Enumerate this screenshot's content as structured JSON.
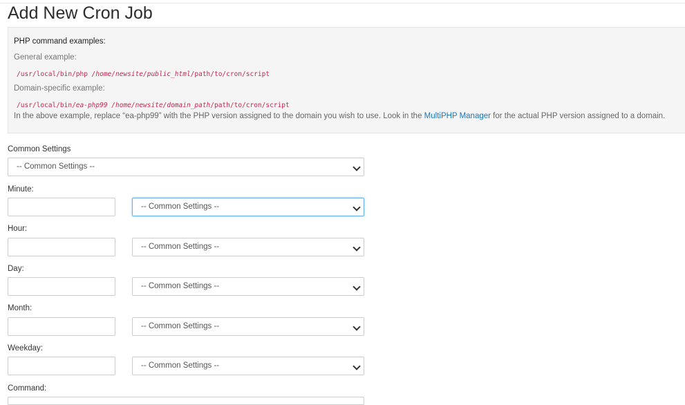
{
  "page": {
    "title": "Add New Cron Job"
  },
  "examples": {
    "heading": "PHP command examples:",
    "general_label": "General example:",
    "general_code_part1": "/usr/local/bin/php ",
    "general_code_part2": "/home/newsite/public_html",
    "general_code_part3": "/path/to/cron/script",
    "domain_label": "Domain-specific example:",
    "domain_code_part1": "/usr/local/bin/",
    "domain_code_part2": "ea-php99",
    "domain_code_part3": " /home/newsite/domain_path",
    "domain_code_part4": "/path/to/cron/script",
    "note_before": "In the above example, replace “ea-php99” with the PHP version assigned to the domain you wish to use. Look in the ",
    "note_link": "MultiPHP Manager",
    "note_after": " for the actual PHP version assigned to a domain."
  },
  "form": {
    "common_settings_label": "Common Settings",
    "common_settings_value": "-- Common Settings --",
    "minute_label": "Minute:",
    "minute_value": "",
    "minute_select": "-- Common Settings --",
    "hour_label": "Hour:",
    "hour_value": "",
    "hour_select": "-- Common Settings --",
    "day_label": "Day:",
    "day_value": "",
    "day_select": "-- Common Settings --",
    "month_label": "Month:",
    "month_value": "",
    "month_select": "-- Common Settings --",
    "weekday_label": "Weekday:",
    "weekday_value": "",
    "weekday_select": "-- Common Settings --",
    "command_label": "Command:"
  }
}
